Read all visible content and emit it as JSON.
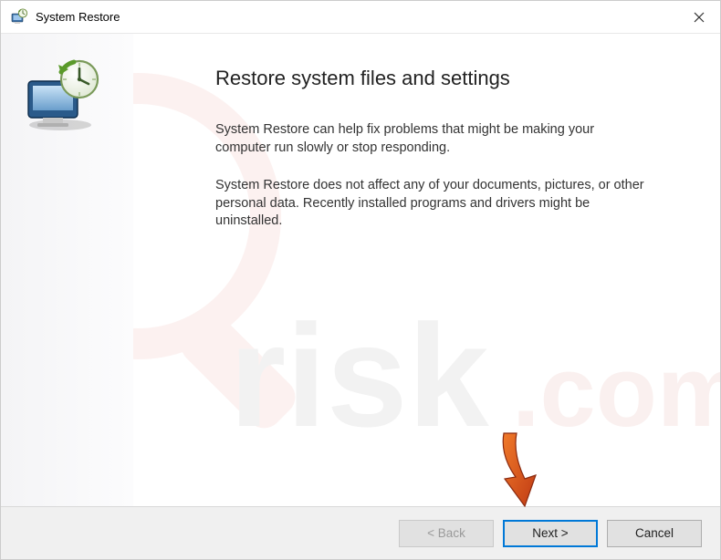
{
  "titlebar": {
    "title": "System Restore"
  },
  "content": {
    "heading": "Restore system files and settings",
    "para1": "System Restore can help fix problems that might be making your computer run slowly or stop responding.",
    "para2": "System Restore does not affect any of your documents, pictures, or other personal data. Recently installed programs and drivers might be uninstalled."
  },
  "footer": {
    "back": "< Back",
    "next": "Next >",
    "cancel": "Cancel"
  }
}
